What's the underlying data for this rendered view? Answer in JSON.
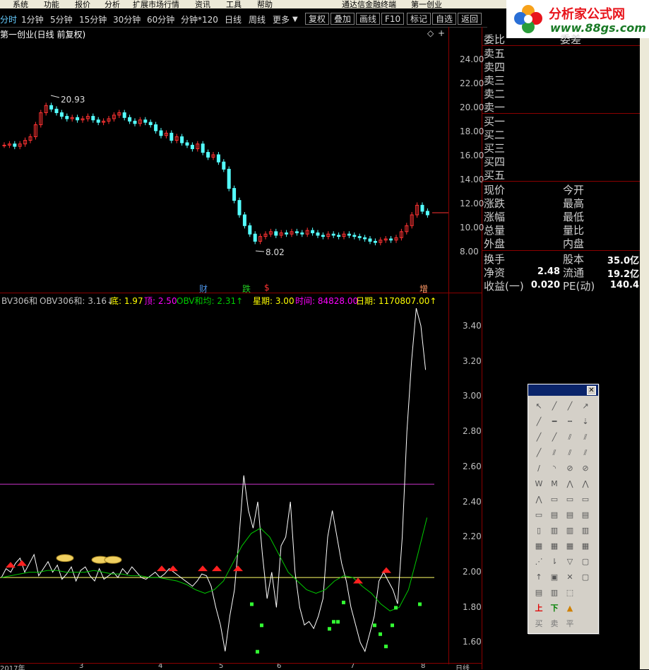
{
  "menu": {
    "items": [
      "系统",
      "功能",
      "报价",
      "分析",
      "扩展市场行情",
      "资讯",
      "工具",
      "帮助"
    ],
    "window_title": "通达信金融终端",
    "stock_name": "第一创业"
  },
  "toolbar": {
    "periods": [
      "分时",
      "1分钟",
      "5分钟",
      "15分钟",
      "30分钟",
      "60分钟",
      "分钟*120",
      "日线",
      "周线",
      "更多"
    ],
    "buttons": [
      "复权",
      "叠加",
      "画线",
      "F10",
      "标记",
      "自选",
      "返回"
    ]
  },
  "logo": {
    "title": "分析家公式网",
    "url": "www.88gs.com"
  },
  "main_chart": {
    "title": "第一创业(日线 前复权)",
    "high_label": "20.93",
    "low_label": "8.02",
    "yticks": [
      "24.00",
      "22.00",
      "20.00",
      "18.00",
      "16.00",
      "14.00",
      "12.00",
      "10.00",
      "8.00"
    ],
    "markers": [
      {
        "text": "财",
        "color": "#4a90e2"
      },
      {
        "text": "跌",
        "color": "#22cc22"
      },
      {
        "text": "$",
        "color": "#ff3333"
      },
      {
        "text": "增",
        "color": "#ff9966"
      }
    ]
  },
  "indicator": {
    "header": [
      {
        "text": "BV306和",
        "color": "#c0c0c0"
      },
      {
        "text": "OBV306和: 3.16↓",
        "color": "#c0c0c0"
      },
      {
        "text": "底: 1.97",
        "color": "#ffff00"
      },
      {
        "text": "顶: 2.50",
        "color": "#ff00ff"
      },
      {
        "text": "OBV和均: 2.31↑",
        "color": "#00cc00"
      },
      {
        "text": "星期: 3.00",
        "color": "#ffff00"
      },
      {
        "text": "时间: 84828.00",
        "color": "#ff00ff"
      },
      {
        "text": "日期: 1170807.00↑",
        "color": "#ffff00"
      }
    ],
    "yticks": [
      "3.40",
      "3.20",
      "3.00",
      "2.80",
      "2.60",
      "2.40",
      "2.20",
      "2.00",
      "1.80",
      "1.60"
    ],
    "xticks": [
      "2017年",
      "3",
      "4",
      "5",
      "6",
      "7",
      "8"
    ],
    "period_label": "日线"
  },
  "quote": {
    "ratio_label": "委比",
    "ratio_right": "委差",
    "sell": [
      "卖五",
      "卖四",
      "卖三",
      "卖二",
      "卖一"
    ],
    "buy": [
      "买一",
      "买二",
      "买三",
      "买四",
      "买五"
    ],
    "left_labels": [
      "现价",
      "涨跌",
      "涨幅",
      "总量",
      "外盘"
    ],
    "right_labels": [
      "今开",
      "最高",
      "最低",
      "量比",
      "内盘"
    ],
    "stats": [
      {
        "l": "换手",
        "lv": "",
        "r": "股本",
        "rv": "35.0亿"
      },
      {
        "l": "净资",
        "lv": "2.48",
        "r": "流通",
        "rv": "19.2亿"
      },
      {
        "l": "收益(一)",
        "lv": "0.020",
        "r": "PE(动)",
        "rv": "140.4"
      }
    ]
  },
  "palette": {
    "bottom_labels": [
      "买",
      "卖",
      "平"
    ]
  },
  "colors": {
    "up": "#ff3232",
    "down": "#54ffff",
    "grid": "#8b0000",
    "obv": "#ffffff",
    "avg": "#00cc00",
    "bottom": "#ffff66",
    "top": "#cc33cc"
  }
}
